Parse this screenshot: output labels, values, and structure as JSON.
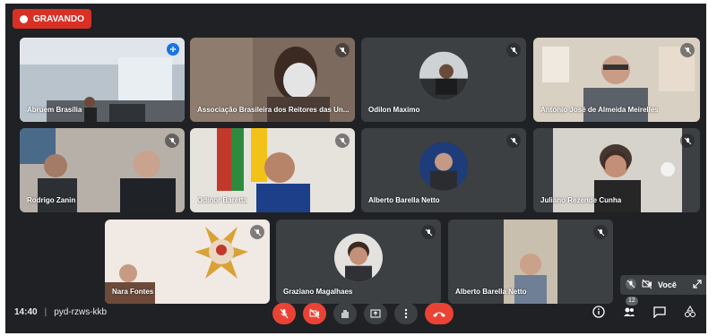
{
  "recording": {
    "label": "GRAVANDO",
    "color": "#d93025"
  },
  "participants": [
    {
      "name": "Abruem Brasília",
      "speaking": true
    },
    {
      "name": "Associação Brasileira dos Reitores das Un..."
    },
    {
      "name": "Odilon Maximo"
    },
    {
      "name": "Antonio José de Almeida Meirelles"
    },
    {
      "name": "Rodrigo Zanin"
    },
    {
      "name": "Odinor Baretta"
    },
    {
      "name": "Alberto Barella Netto"
    },
    {
      "name": "Juliano Rezende Cunha"
    },
    {
      "name": "Nara Fontes"
    },
    {
      "name": "Graziano Magalhaes"
    },
    {
      "name": "Alberto Barella Netto"
    }
  ],
  "self_view": {
    "label": "Você"
  },
  "bottom_bar": {
    "time": "14:40",
    "separator": "|",
    "meeting_code": "pyd-rzws-kkb",
    "participant_count": "12",
    "icons": [
      "mic-off-icon",
      "camera-off-icon",
      "raise-hand-icon",
      "present-icon",
      "more-icon",
      "hang-up-icon",
      "info-icon",
      "people-icon",
      "chat-icon",
      "activities-icon"
    ]
  },
  "colors": {
    "background": "#202124",
    "tile": "#3c4043",
    "danger": "#ea4335",
    "active_border": "#8ab4f8"
  }
}
